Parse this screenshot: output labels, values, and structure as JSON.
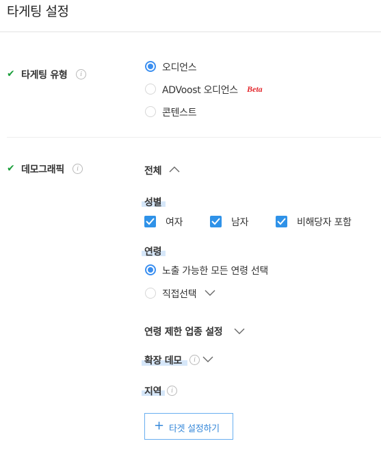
{
  "page": {
    "title": "타게팅 설정"
  },
  "targeting_type": {
    "label": "타게팅 유형",
    "options": [
      {
        "label": "오디언스",
        "selected": true
      },
      {
        "label": "ADVoost 오디언스",
        "badge": "Beta",
        "selected": false
      },
      {
        "label": "콘텐스트",
        "selected": false
      }
    ]
  },
  "demographic": {
    "label": "데모그래픽",
    "scope": {
      "label": "전체",
      "state": "expanded"
    },
    "gender": {
      "label": "성별",
      "options": [
        {
          "label": "여자",
          "checked": true
        },
        {
          "label": "남자",
          "checked": true
        },
        {
          "label": "비해당자 포함",
          "checked": true
        }
      ]
    },
    "age": {
      "label": "연령",
      "options": [
        {
          "label": "노출 가능한 모든 연령 선택",
          "selected": true
        },
        {
          "label": "직접선택",
          "selected": false
        }
      ]
    },
    "age_restriction": {
      "label": "연령 제한 업종 설정"
    },
    "extended_demo": {
      "label": "확장 데모"
    },
    "region": {
      "label": "지역"
    },
    "target_button": {
      "icon": "+",
      "label": "타겟 설정하기"
    }
  },
  "colors": {
    "accent": "#3b8ff0",
    "check": "#1a9e3a",
    "beta": "#e3262b",
    "highlight": "#cfe3f8"
  }
}
